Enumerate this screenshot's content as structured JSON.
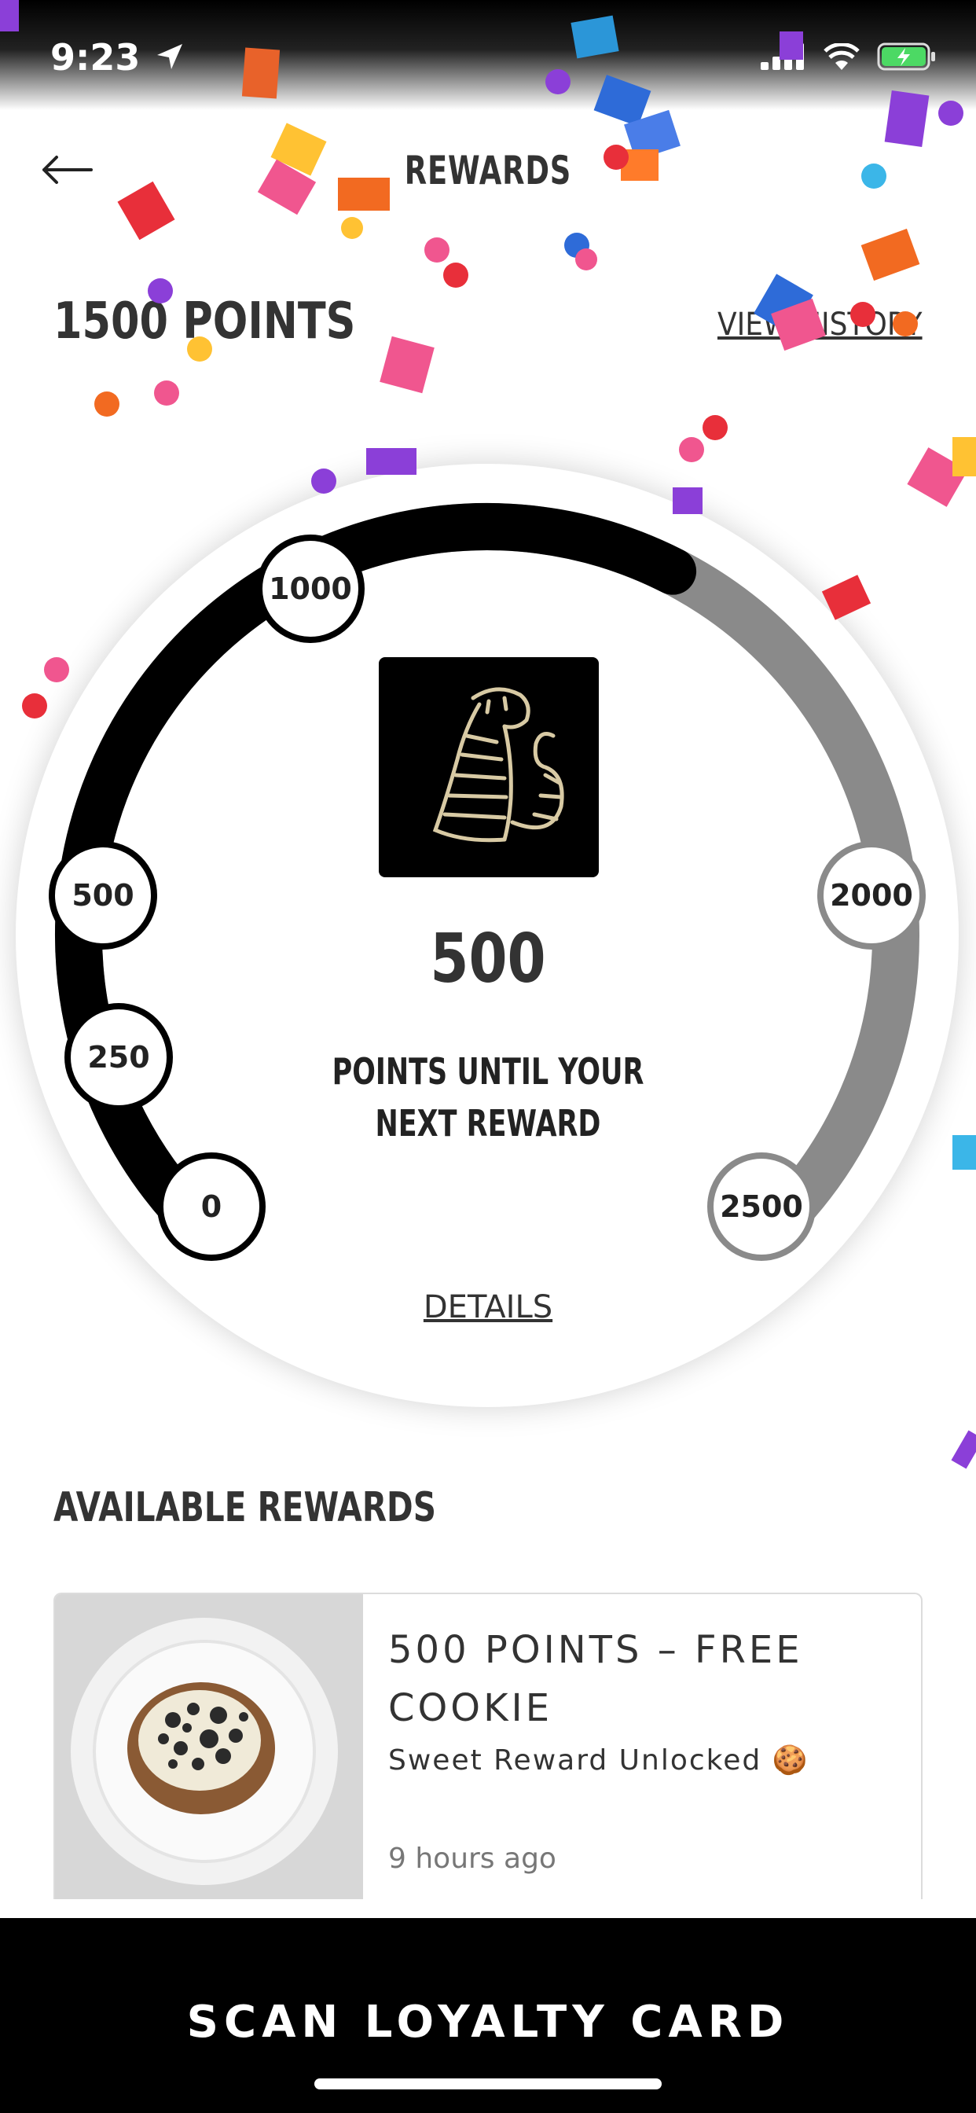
{
  "status_bar": {
    "time": "9:23"
  },
  "header": {
    "title": "REWARDS"
  },
  "summary": {
    "points_total": "1500 POINTS",
    "view_history_label": "VIEW HISTORY"
  },
  "progress_dial": {
    "milestones": [
      "0",
      "250",
      "500",
      "1000",
      "2000",
      "2500"
    ],
    "current_points": 1500,
    "max_points": 2500,
    "next_value": "500",
    "next_caption": "POINTS UNTIL YOUR NEXT REWARD",
    "details_label": "DETAILS",
    "progress_color": "#000000",
    "track_color": "#8a8a8a"
  },
  "available_rewards": {
    "section_title": "AVAILABLE REWARDS",
    "items": [
      {
        "title": "500 POINTS – FREE COOKIE",
        "subtitle": "Sweet Reward Unlocked 🍪",
        "time": "9 hours ago"
      }
    ]
  },
  "bottom_action": {
    "label": "SCAN LOYALTY CARD"
  }
}
